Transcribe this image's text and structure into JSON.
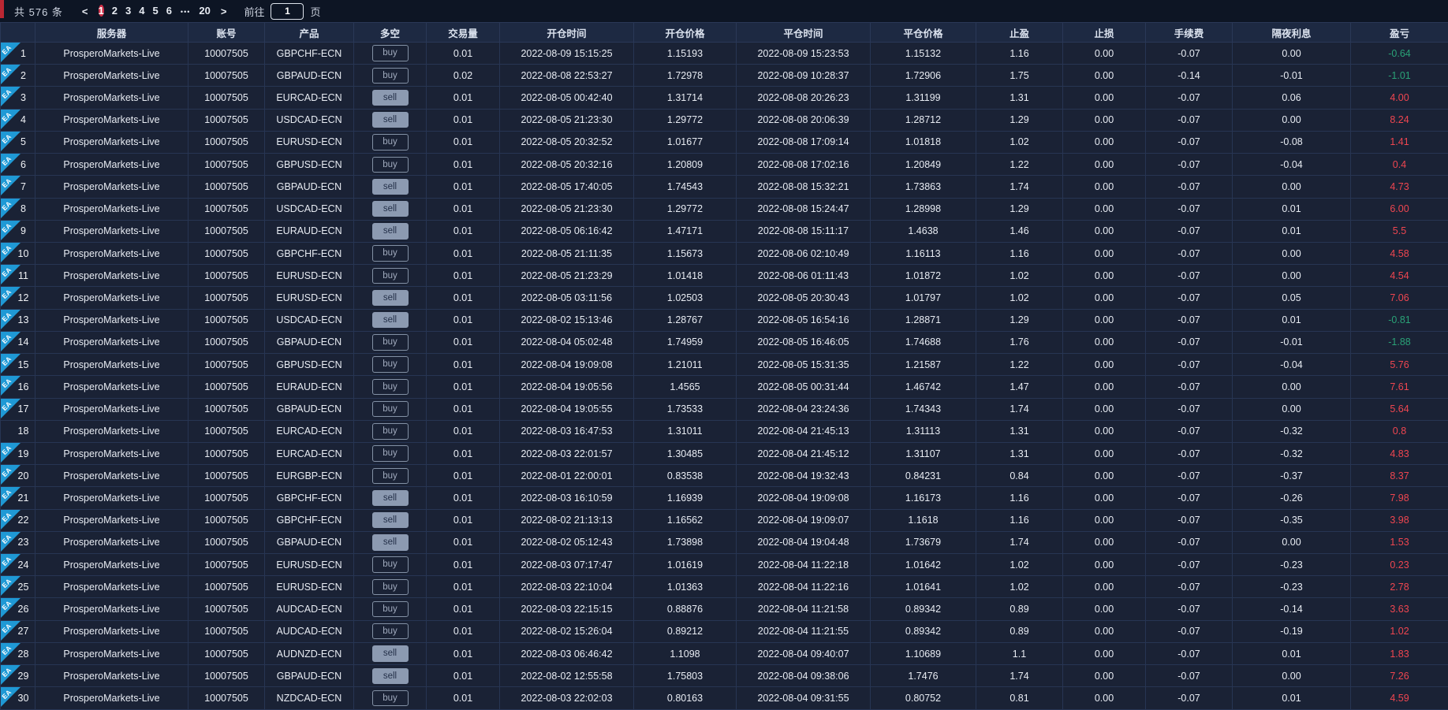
{
  "colors": {
    "accent_red_active_page": "#d13049",
    "left_strip_red": "#bb2733",
    "profit_positive_red": "#ef4650",
    "profit_negative_green": "#2aa277",
    "ea_badge_blue": "#1f99d5",
    "sell_badge_gray": "#8c9ab1",
    "header_bg": "#1d2942",
    "row_bg": "#1a2235"
  },
  "pagination": {
    "total_label": "共 576 条",
    "prev_icon": "<",
    "next_icon": ">",
    "pages": [
      "1",
      "2",
      "3",
      "4",
      "5",
      "6"
    ],
    "more_icon": "•••",
    "last_page": "20",
    "active_page": "1",
    "goto_prefix": "前往",
    "goto_value": "1",
    "goto_suffix": "页"
  },
  "table": {
    "ea_badge_label": "EA",
    "columns": [
      "服务器",
      "账号",
      "产品",
      "多空",
      "交易量",
      "开仓时间",
      "开仓价格",
      "平仓时间",
      "平仓价格",
      "止盈",
      "止损",
      "手续费",
      "隔夜利息",
      "盈亏"
    ],
    "rows": [
      {
        "num": "1",
        "ea": true,
        "server": "ProsperoMarkets-Live",
        "account": "10007505",
        "product": "GBPCHF-ECN",
        "direction": "buy",
        "volume": "0.01",
        "open_time": "2022-08-09 15:15:25",
        "open_price": "1.15193",
        "close_time": "2022-08-09 15:23:53",
        "close_price": "1.15132",
        "take_profit": "1.16",
        "stop_loss": "0.00",
        "commission": "-0.07",
        "swap": "0.00",
        "profit": "-0.64"
      },
      {
        "num": "2",
        "ea": true,
        "server": "ProsperoMarkets-Live",
        "account": "10007505",
        "product": "GBPAUD-ECN",
        "direction": "buy",
        "volume": "0.02",
        "open_time": "2022-08-08 22:53:27",
        "open_price": "1.72978",
        "close_time": "2022-08-09 10:28:37",
        "close_price": "1.72906",
        "take_profit": "1.75",
        "stop_loss": "0.00",
        "commission": "-0.14",
        "swap": "-0.01",
        "profit": "-1.01"
      },
      {
        "num": "3",
        "ea": true,
        "server": "ProsperoMarkets-Live",
        "account": "10007505",
        "product": "EURCAD-ECN",
        "direction": "sell",
        "volume": "0.01",
        "open_time": "2022-08-05 00:42:40",
        "open_price": "1.31714",
        "close_time": "2022-08-08 20:26:23",
        "close_price": "1.31199",
        "take_profit": "1.31",
        "stop_loss": "0.00",
        "commission": "-0.07",
        "swap": "0.06",
        "profit": "4.00"
      },
      {
        "num": "4",
        "ea": true,
        "server": "ProsperoMarkets-Live",
        "account": "10007505",
        "product": "USDCAD-ECN",
        "direction": "sell",
        "volume": "0.01",
        "open_time": "2022-08-05 21:23:30",
        "open_price": "1.29772",
        "close_time": "2022-08-08 20:06:39",
        "close_price": "1.28712",
        "take_profit": "1.29",
        "stop_loss": "0.00",
        "commission": "-0.07",
        "swap": "0.00",
        "profit": "8.24"
      },
      {
        "num": "5",
        "ea": true,
        "server": "ProsperoMarkets-Live",
        "account": "10007505",
        "product": "EURUSD-ECN",
        "direction": "buy",
        "volume": "0.01",
        "open_time": "2022-08-05 20:32:52",
        "open_price": "1.01677",
        "close_time": "2022-08-08 17:09:14",
        "close_price": "1.01818",
        "take_profit": "1.02",
        "stop_loss": "0.00",
        "commission": "-0.07",
        "swap": "-0.08",
        "profit": "1.41"
      },
      {
        "num": "6",
        "ea": true,
        "server": "ProsperoMarkets-Live",
        "account": "10007505",
        "product": "GBPUSD-ECN",
        "direction": "buy",
        "volume": "0.01",
        "open_time": "2022-08-05 20:32:16",
        "open_price": "1.20809",
        "close_time": "2022-08-08 17:02:16",
        "close_price": "1.20849",
        "take_profit": "1.22",
        "stop_loss": "0.00",
        "commission": "-0.07",
        "swap": "-0.04",
        "profit": "0.4"
      },
      {
        "num": "7",
        "ea": true,
        "server": "ProsperoMarkets-Live",
        "account": "10007505",
        "product": "GBPAUD-ECN",
        "direction": "sell",
        "volume": "0.01",
        "open_time": "2022-08-05 17:40:05",
        "open_price": "1.74543",
        "close_time": "2022-08-08 15:32:21",
        "close_price": "1.73863",
        "take_profit": "1.74",
        "stop_loss": "0.00",
        "commission": "-0.07",
        "swap": "0.00",
        "profit": "4.73"
      },
      {
        "num": "8",
        "ea": true,
        "server": "ProsperoMarkets-Live",
        "account": "10007505",
        "product": "USDCAD-ECN",
        "direction": "sell",
        "volume": "0.01",
        "open_time": "2022-08-05 21:23:30",
        "open_price": "1.29772",
        "close_time": "2022-08-08 15:24:47",
        "close_price": "1.28998",
        "take_profit": "1.29",
        "stop_loss": "0.00",
        "commission": "-0.07",
        "swap": "0.01",
        "profit": "6.00"
      },
      {
        "num": "9",
        "ea": true,
        "server": "ProsperoMarkets-Live",
        "account": "10007505",
        "product": "EURAUD-ECN",
        "direction": "sell",
        "volume": "0.01",
        "open_time": "2022-08-05 06:16:42",
        "open_price": "1.47171",
        "close_time": "2022-08-08 15:11:17",
        "close_price": "1.4638",
        "take_profit": "1.46",
        "stop_loss": "0.00",
        "commission": "-0.07",
        "swap": "0.01",
        "profit": "5.5"
      },
      {
        "num": "10",
        "ea": true,
        "server": "ProsperoMarkets-Live",
        "account": "10007505",
        "product": "GBPCHF-ECN",
        "direction": "buy",
        "volume": "0.01",
        "open_time": "2022-08-05 21:11:35",
        "open_price": "1.15673",
        "close_time": "2022-08-06 02:10:49",
        "close_price": "1.16113",
        "take_profit": "1.16",
        "stop_loss": "0.00",
        "commission": "-0.07",
        "swap": "0.00",
        "profit": "4.58"
      },
      {
        "num": "11",
        "ea": true,
        "server": "ProsperoMarkets-Live",
        "account": "10007505",
        "product": "EURUSD-ECN",
        "direction": "buy",
        "volume": "0.01",
        "open_time": "2022-08-05 21:23:29",
        "open_price": "1.01418",
        "close_time": "2022-08-06 01:11:43",
        "close_price": "1.01872",
        "take_profit": "1.02",
        "stop_loss": "0.00",
        "commission": "-0.07",
        "swap": "0.00",
        "profit": "4.54"
      },
      {
        "num": "12",
        "ea": true,
        "server": "ProsperoMarkets-Live",
        "account": "10007505",
        "product": "EURUSD-ECN",
        "direction": "sell",
        "volume": "0.01",
        "open_time": "2022-08-05 03:11:56",
        "open_price": "1.02503",
        "close_time": "2022-08-05 20:30:43",
        "close_price": "1.01797",
        "take_profit": "1.02",
        "stop_loss": "0.00",
        "commission": "-0.07",
        "swap": "0.05",
        "profit": "7.06"
      },
      {
        "num": "13",
        "ea": true,
        "server": "ProsperoMarkets-Live",
        "account": "10007505",
        "product": "USDCAD-ECN",
        "direction": "sell",
        "volume": "0.01",
        "open_time": "2022-08-02 15:13:46",
        "open_price": "1.28767",
        "close_time": "2022-08-05 16:54:16",
        "close_price": "1.28871",
        "take_profit": "1.29",
        "stop_loss": "0.00",
        "commission": "-0.07",
        "swap": "0.01",
        "profit": "-0.81"
      },
      {
        "num": "14",
        "ea": true,
        "server": "ProsperoMarkets-Live",
        "account": "10007505",
        "product": "GBPAUD-ECN",
        "direction": "buy",
        "volume": "0.01",
        "open_time": "2022-08-04 05:02:48",
        "open_price": "1.74959",
        "close_time": "2022-08-05 16:46:05",
        "close_price": "1.74688",
        "take_profit": "1.76",
        "stop_loss": "0.00",
        "commission": "-0.07",
        "swap": "-0.01",
        "profit": "-1.88"
      },
      {
        "num": "15",
        "ea": true,
        "server": "ProsperoMarkets-Live",
        "account": "10007505",
        "product": "GBPUSD-ECN",
        "direction": "buy",
        "volume": "0.01",
        "open_time": "2022-08-04 19:09:08",
        "open_price": "1.21011",
        "close_time": "2022-08-05 15:31:35",
        "close_price": "1.21587",
        "take_profit": "1.22",
        "stop_loss": "0.00",
        "commission": "-0.07",
        "swap": "-0.04",
        "profit": "5.76"
      },
      {
        "num": "16",
        "ea": true,
        "server": "ProsperoMarkets-Live",
        "account": "10007505",
        "product": "EURAUD-ECN",
        "direction": "buy",
        "volume": "0.01",
        "open_time": "2022-08-04 19:05:56",
        "open_price": "1.4565",
        "close_time": "2022-08-05 00:31:44",
        "close_price": "1.46742",
        "take_profit": "1.47",
        "stop_loss": "0.00",
        "commission": "-0.07",
        "swap": "0.00",
        "profit": "7.61"
      },
      {
        "num": "17",
        "ea": true,
        "server": "ProsperoMarkets-Live",
        "account": "10007505",
        "product": "GBPAUD-ECN",
        "direction": "buy",
        "volume": "0.01",
        "open_time": "2022-08-04 19:05:55",
        "open_price": "1.73533",
        "close_time": "2022-08-04 23:24:36",
        "close_price": "1.74343",
        "take_profit": "1.74",
        "stop_loss": "0.00",
        "commission": "-0.07",
        "swap": "0.00",
        "profit": "5.64"
      },
      {
        "num": "18",
        "ea": false,
        "server": "ProsperoMarkets-Live",
        "account": "10007505",
        "product": "EURCAD-ECN",
        "direction": "buy",
        "volume": "0.01",
        "open_time": "2022-08-03 16:47:53",
        "open_price": "1.31011",
        "close_time": "2022-08-04 21:45:13",
        "close_price": "1.31113",
        "take_profit": "1.31",
        "stop_loss": "0.00",
        "commission": "-0.07",
        "swap": "-0.32",
        "profit": "0.8"
      },
      {
        "num": "19",
        "ea": true,
        "server": "ProsperoMarkets-Live",
        "account": "10007505",
        "product": "EURCAD-ECN",
        "direction": "buy",
        "volume": "0.01",
        "open_time": "2022-08-03 22:01:57",
        "open_price": "1.30485",
        "close_time": "2022-08-04 21:45:12",
        "close_price": "1.31107",
        "take_profit": "1.31",
        "stop_loss": "0.00",
        "commission": "-0.07",
        "swap": "-0.32",
        "profit": "4.83"
      },
      {
        "num": "20",
        "ea": true,
        "server": "ProsperoMarkets-Live",
        "account": "10007505",
        "product": "EURGBP-ECN",
        "direction": "buy",
        "volume": "0.01",
        "open_time": "2022-08-01 22:00:01",
        "open_price": "0.83538",
        "close_time": "2022-08-04 19:32:43",
        "close_price": "0.84231",
        "take_profit": "0.84",
        "stop_loss": "0.00",
        "commission": "-0.07",
        "swap": "-0.37",
        "profit": "8.37"
      },
      {
        "num": "21",
        "ea": true,
        "server": "ProsperoMarkets-Live",
        "account": "10007505",
        "product": "GBPCHF-ECN",
        "direction": "sell",
        "volume": "0.01",
        "open_time": "2022-08-03 16:10:59",
        "open_price": "1.16939",
        "close_time": "2022-08-04 19:09:08",
        "close_price": "1.16173",
        "take_profit": "1.16",
        "stop_loss": "0.00",
        "commission": "-0.07",
        "swap": "-0.26",
        "profit": "7.98"
      },
      {
        "num": "22",
        "ea": true,
        "server": "ProsperoMarkets-Live",
        "account": "10007505",
        "product": "GBPCHF-ECN",
        "direction": "sell",
        "volume": "0.01",
        "open_time": "2022-08-02 21:13:13",
        "open_price": "1.16562",
        "close_time": "2022-08-04 19:09:07",
        "close_price": "1.1618",
        "take_profit": "1.16",
        "stop_loss": "0.00",
        "commission": "-0.07",
        "swap": "-0.35",
        "profit": "3.98"
      },
      {
        "num": "23",
        "ea": true,
        "server": "ProsperoMarkets-Live",
        "account": "10007505",
        "product": "GBPAUD-ECN",
        "direction": "sell",
        "volume": "0.01",
        "open_time": "2022-08-02 05:12:43",
        "open_price": "1.73898",
        "close_time": "2022-08-04 19:04:48",
        "close_price": "1.73679",
        "take_profit": "1.74",
        "stop_loss": "0.00",
        "commission": "-0.07",
        "swap": "0.00",
        "profit": "1.53"
      },
      {
        "num": "24",
        "ea": true,
        "server": "ProsperoMarkets-Live",
        "account": "10007505",
        "product": "EURUSD-ECN",
        "direction": "buy",
        "volume": "0.01",
        "open_time": "2022-08-03 07:17:47",
        "open_price": "1.01619",
        "close_time": "2022-08-04 11:22:18",
        "close_price": "1.01642",
        "take_profit": "1.02",
        "stop_loss": "0.00",
        "commission": "-0.07",
        "swap": "-0.23",
        "profit": "0.23"
      },
      {
        "num": "25",
        "ea": true,
        "server": "ProsperoMarkets-Live",
        "account": "10007505",
        "product": "EURUSD-ECN",
        "direction": "buy",
        "volume": "0.01",
        "open_time": "2022-08-03 22:10:04",
        "open_price": "1.01363",
        "close_time": "2022-08-04 11:22:16",
        "close_price": "1.01641",
        "take_profit": "1.02",
        "stop_loss": "0.00",
        "commission": "-0.07",
        "swap": "-0.23",
        "profit": "2.78"
      },
      {
        "num": "26",
        "ea": true,
        "server": "ProsperoMarkets-Live",
        "account": "10007505",
        "product": "AUDCAD-ECN",
        "direction": "buy",
        "volume": "0.01",
        "open_time": "2022-08-03 22:15:15",
        "open_price": "0.88876",
        "close_time": "2022-08-04 11:21:58",
        "close_price": "0.89342",
        "take_profit": "0.89",
        "stop_loss": "0.00",
        "commission": "-0.07",
        "swap": "-0.14",
        "profit": "3.63"
      },
      {
        "num": "27",
        "ea": true,
        "server": "ProsperoMarkets-Live",
        "account": "10007505",
        "product": "AUDCAD-ECN",
        "direction": "buy",
        "volume": "0.01",
        "open_time": "2022-08-02 15:26:04",
        "open_price": "0.89212",
        "close_time": "2022-08-04 11:21:55",
        "close_price": "0.89342",
        "take_profit": "0.89",
        "stop_loss": "0.00",
        "commission": "-0.07",
        "swap": "-0.19",
        "profit": "1.02"
      },
      {
        "num": "28",
        "ea": true,
        "server": "ProsperoMarkets-Live",
        "account": "10007505",
        "product": "AUDNZD-ECN",
        "direction": "sell",
        "volume": "0.01",
        "open_time": "2022-08-03 06:46:42",
        "open_price": "1.1098",
        "close_time": "2022-08-04 09:40:07",
        "close_price": "1.10689",
        "take_profit": "1.1",
        "stop_loss": "0.00",
        "commission": "-0.07",
        "swap": "0.01",
        "profit": "1.83"
      },
      {
        "num": "29",
        "ea": true,
        "server": "ProsperoMarkets-Live",
        "account": "10007505",
        "product": "GBPAUD-ECN",
        "direction": "sell",
        "volume": "0.01",
        "open_time": "2022-08-02 12:55:58",
        "open_price": "1.75803",
        "close_time": "2022-08-04 09:38:06",
        "close_price": "1.7476",
        "take_profit": "1.74",
        "stop_loss": "0.00",
        "commission": "-0.07",
        "swap": "0.00",
        "profit": "7.26"
      },
      {
        "num": "30",
        "ea": true,
        "server": "ProsperoMarkets-Live",
        "account": "10007505",
        "product": "NZDCAD-ECN",
        "direction": "buy",
        "volume": "0.01",
        "open_time": "2022-08-03 22:02:03",
        "open_price": "0.80163",
        "close_time": "2022-08-04 09:31:55",
        "close_price": "0.80752",
        "take_profit": "0.81",
        "stop_loss": "0.00",
        "commission": "-0.07",
        "swap": "0.01",
        "profit": "4.59"
      }
    ]
  }
}
